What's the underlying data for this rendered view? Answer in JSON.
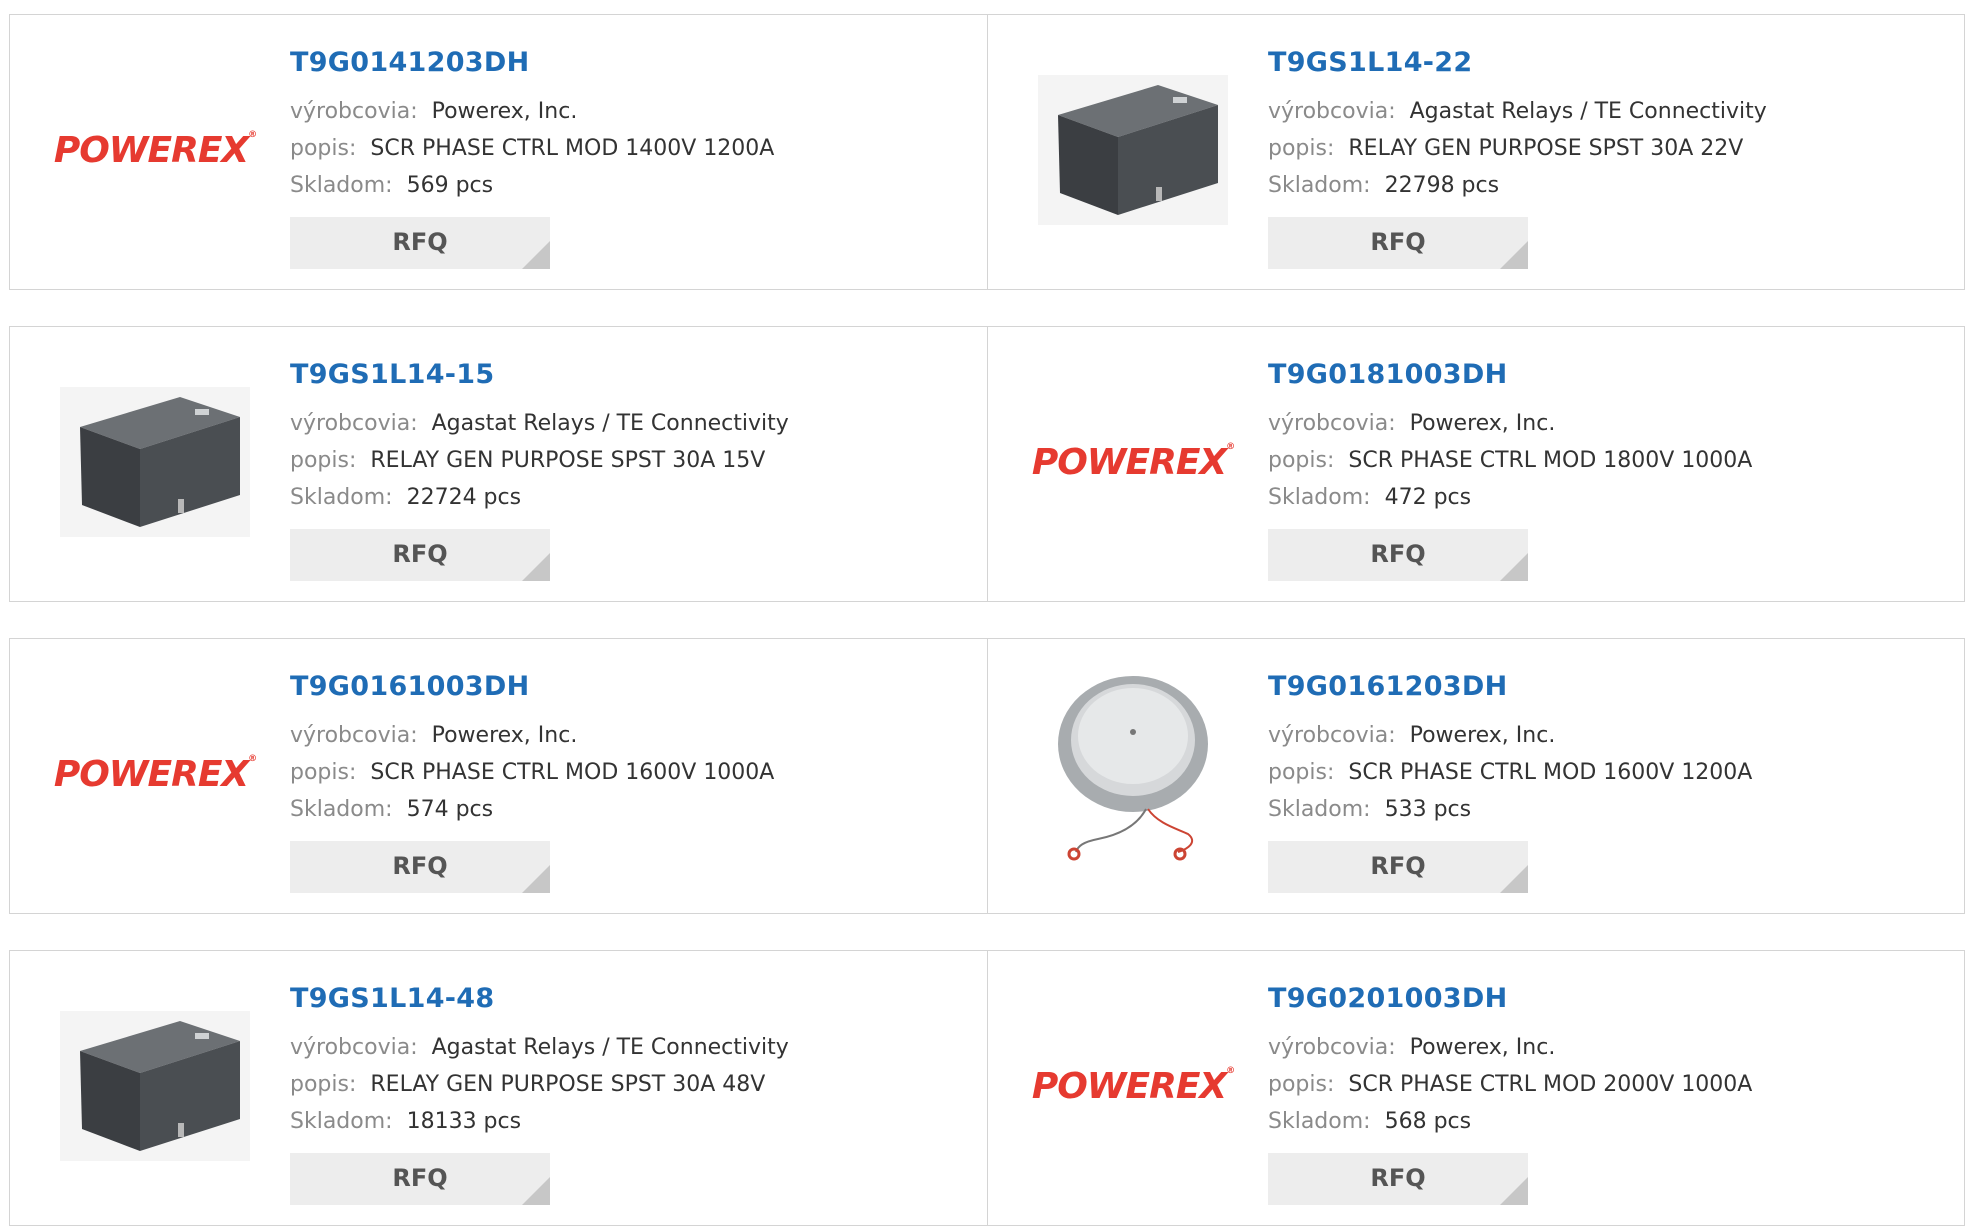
{
  "labels": {
    "manufacturer": "výrobcovia:",
    "description": "popis:",
    "stock": "Skladom:",
    "rfq": "RFQ"
  },
  "colors": {
    "link": "#1f6cb5",
    "powerex_red": "#e63a30",
    "button_bg": "#ededed"
  },
  "products": [
    {
      "pn": "T9G0141203DH",
      "manufacturer": "Powerex, Inc.",
      "description": "SCR PHASE CTRL MOD 1400V 1200A",
      "stock": "569 pcs",
      "image": "powerex-logo"
    },
    {
      "pn": "T9GS1L14-22",
      "manufacturer": "Agastat Relays / TE Connectivity",
      "description": "RELAY GEN PURPOSE SPST 30A 22V",
      "stock": "22798 pcs",
      "image": "relay-photo"
    },
    {
      "pn": "T9GS1L14-15",
      "manufacturer": "Agastat Relays / TE Connectivity",
      "description": "RELAY GEN PURPOSE SPST 30A 15V",
      "stock": "22724 pcs",
      "image": "relay-photo"
    },
    {
      "pn": "T9G0181003DH",
      "manufacturer": "Powerex, Inc.",
      "description": "SCR PHASE CTRL MOD 1800V 1000A",
      "stock": "472 pcs",
      "image": "powerex-logo"
    },
    {
      "pn": "T9G0161003DH",
      "manufacturer": "Powerex, Inc.",
      "description": "SCR PHASE CTRL MOD 1600V 1000A",
      "stock": "574 pcs",
      "image": "powerex-logo"
    },
    {
      "pn": "T9G0161203DH",
      "manufacturer": "Powerex, Inc.",
      "description": "SCR PHASE CTRL MOD 1600V 1200A",
      "stock": "533 pcs",
      "image": "disc-thyristor-photo"
    },
    {
      "pn": "T9GS1L14-48",
      "manufacturer": "Agastat Relays / TE Connectivity",
      "description": "RELAY GEN PURPOSE SPST 30A 48V",
      "stock": "18133 pcs",
      "image": "relay-photo"
    },
    {
      "pn": "T9G0201003DH",
      "manufacturer": "Powerex, Inc.",
      "description": "SCR PHASE CTRL MOD 2000V 1000A",
      "stock": "568 pcs",
      "image": "powerex-logo"
    }
  ],
  "logo_text": "POWEREX"
}
